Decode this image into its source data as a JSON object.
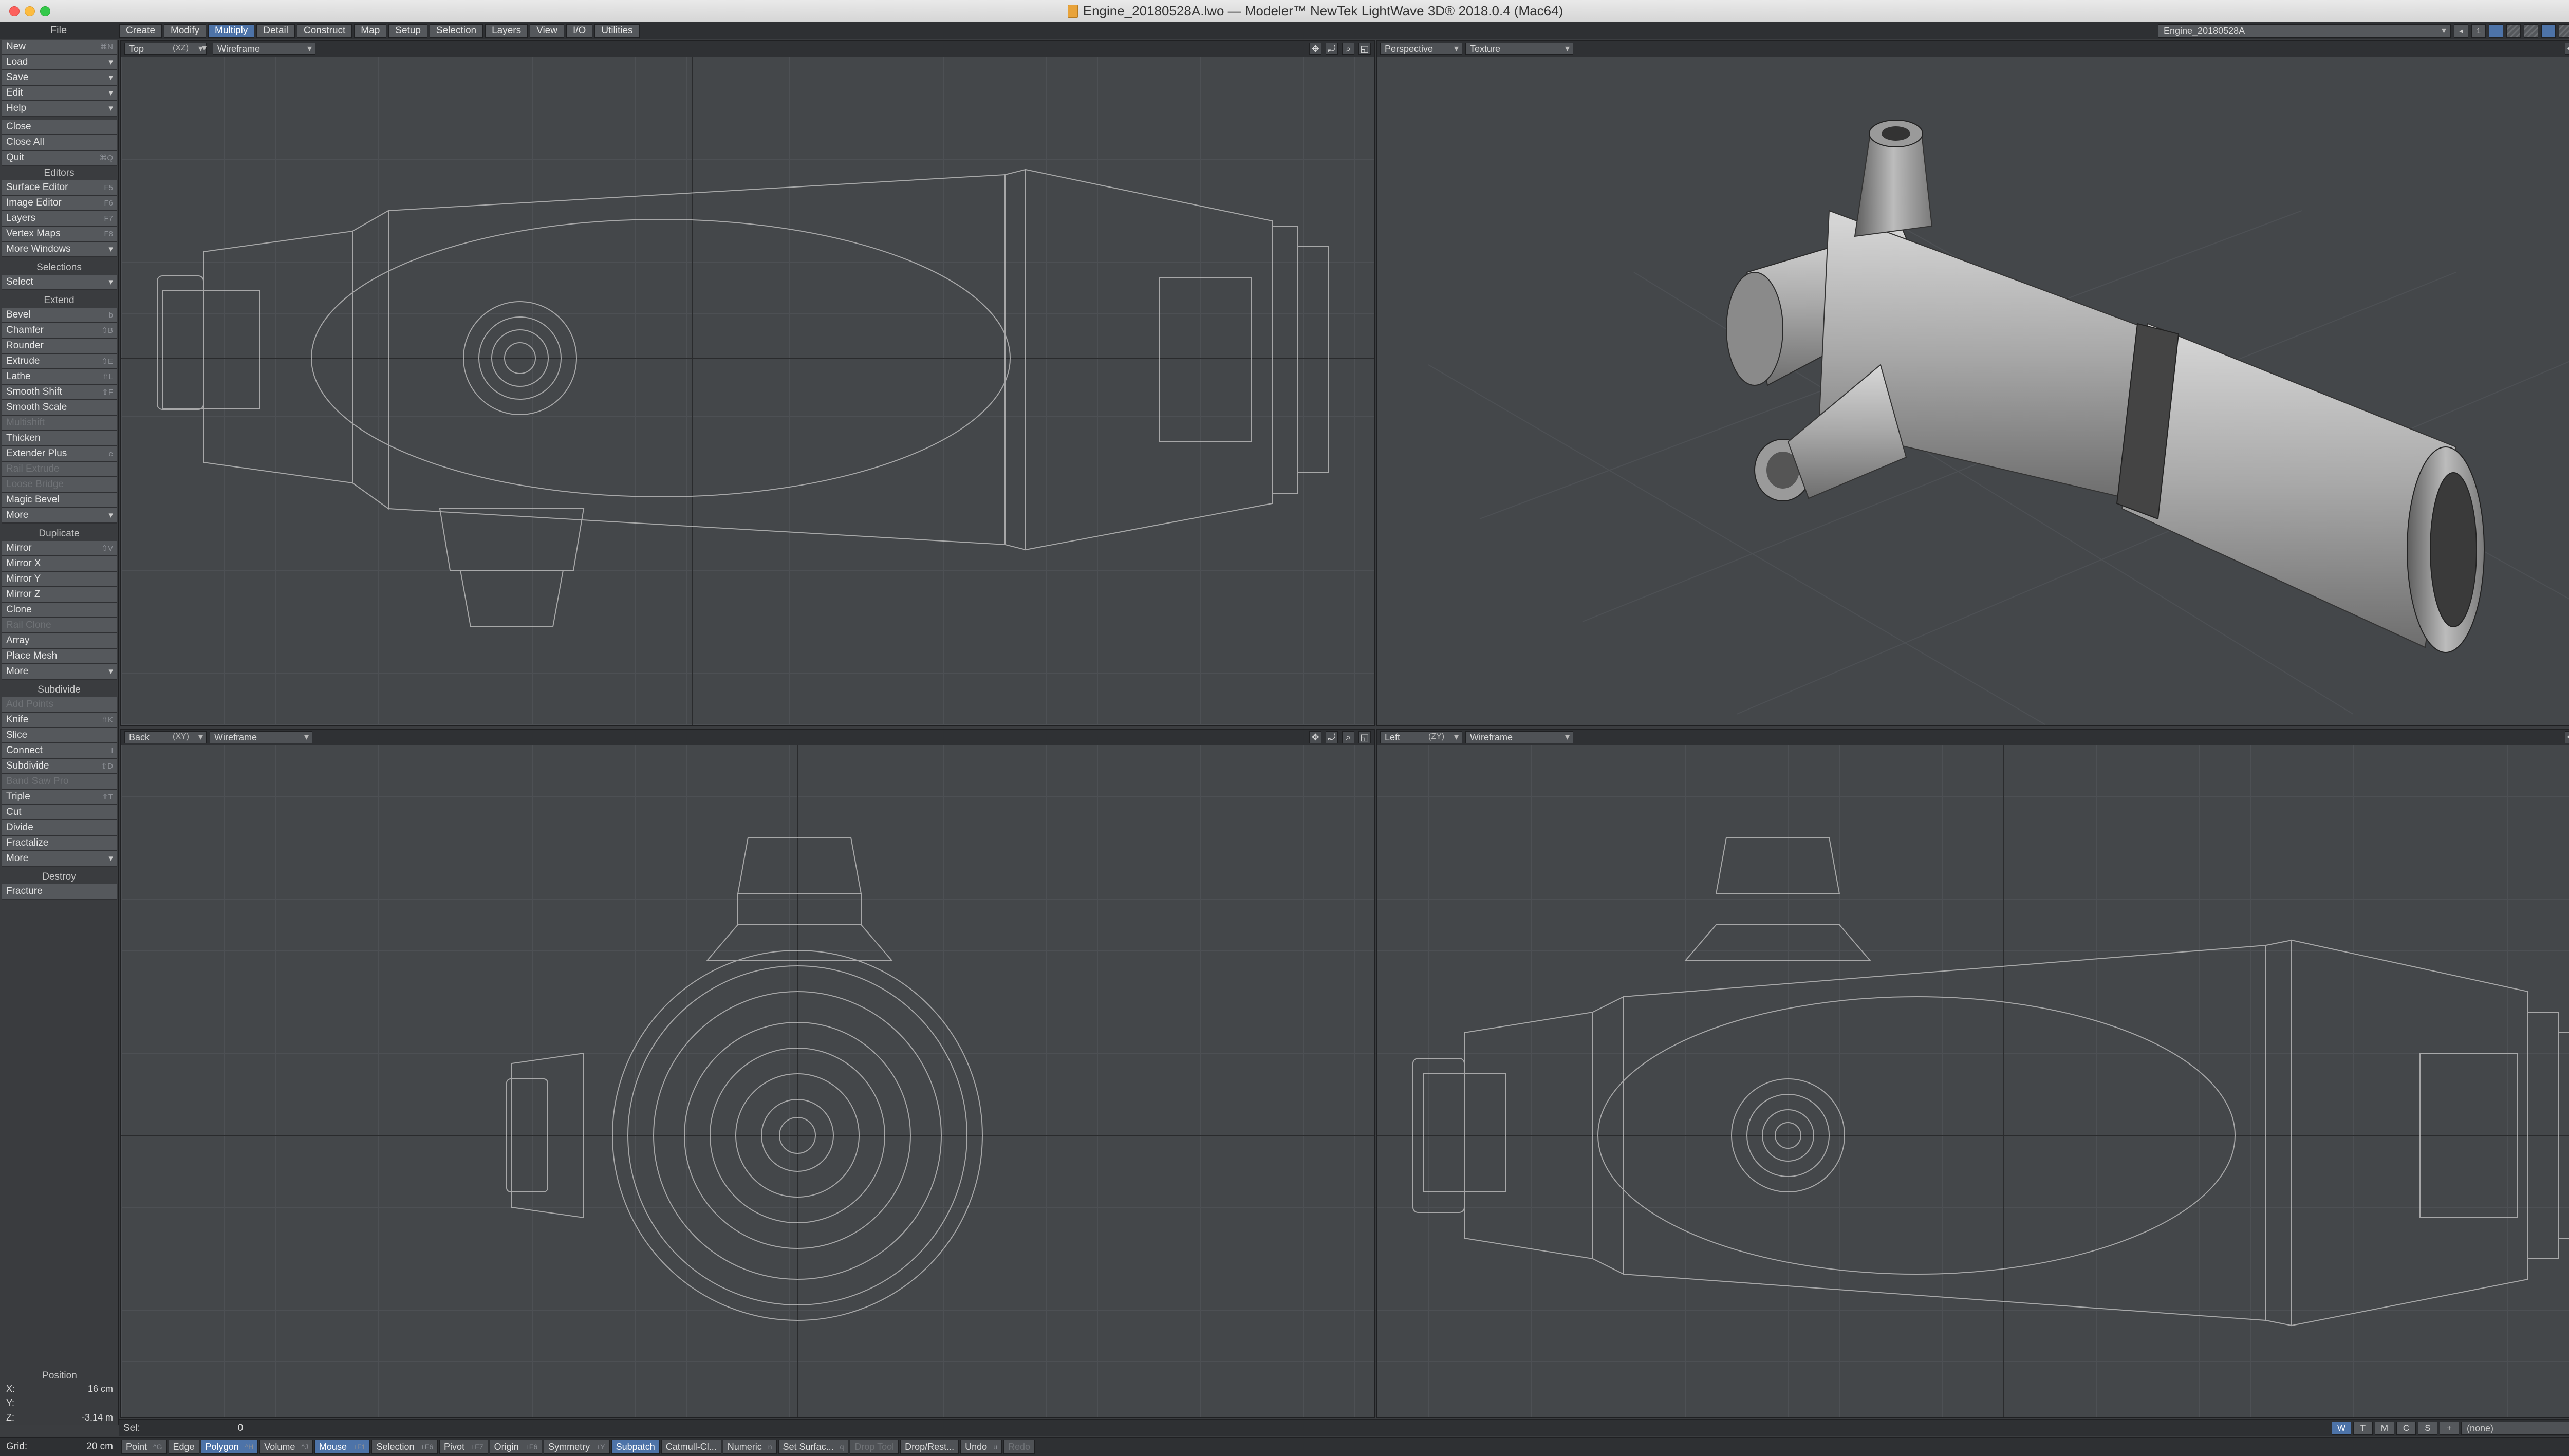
{
  "window": {
    "title": "Engine_20180528A.lwo — Modeler™ NewTek LightWave 3D® 2018.0.4 (Mac64)"
  },
  "menubar": {
    "file_label": "File",
    "tabs": [
      {
        "label": "Create",
        "active": false
      },
      {
        "label": "Modify",
        "active": false
      },
      {
        "label": "Multiply",
        "active": true
      },
      {
        "label": "Detail",
        "active": false
      },
      {
        "label": "Construct",
        "active": false
      },
      {
        "label": "Map",
        "active": false
      },
      {
        "label": "Setup",
        "active": false
      },
      {
        "label": "Selection",
        "active": false
      },
      {
        "label": "Layers",
        "active": false
      },
      {
        "label": "View",
        "active": false
      },
      {
        "label": "I/O",
        "active": false
      },
      {
        "label": "Utilities",
        "active": false
      }
    ],
    "object_select": "Engine_20180528A",
    "layer_number": "1"
  },
  "sidebar": {
    "file_items": [
      {
        "label": "New",
        "shortcut": "⌘N"
      },
      {
        "label": "Load",
        "shortcut": "",
        "dropdown": true
      },
      {
        "label": "Save",
        "shortcut": "",
        "dropdown": true
      },
      {
        "label": "Edit",
        "shortcut": "",
        "dropdown": true
      },
      {
        "label": "Help",
        "shortcut": "",
        "dropdown": true
      }
    ],
    "file_items2": [
      {
        "label": "Close",
        "shortcut": ""
      },
      {
        "label": "Close All",
        "shortcut": ""
      },
      {
        "label": "Quit",
        "shortcut": "⌘Q"
      }
    ],
    "editors_header": "Editors",
    "editors": [
      {
        "label": "Surface Editor",
        "shortcut": "F5"
      },
      {
        "label": "Image Editor",
        "shortcut": "F6"
      },
      {
        "label": "Layers",
        "shortcut": "F7"
      },
      {
        "label": "Vertex Maps",
        "shortcut": "F8"
      },
      {
        "label": "More Windows",
        "shortcut": "",
        "dropdown": true
      }
    ],
    "selections_header": "Selections",
    "selections": [
      {
        "label": "Select",
        "shortcut": "",
        "dropdown": true
      }
    ],
    "extend_header": "Extend",
    "extend": [
      {
        "label": "Bevel",
        "shortcut": "b"
      },
      {
        "label": "Chamfer",
        "shortcut": "⇧B"
      },
      {
        "label": "Rounder",
        "shortcut": ""
      },
      {
        "label": "Extrude",
        "shortcut": "⇧E"
      },
      {
        "label": "Lathe",
        "shortcut": "⇧L"
      },
      {
        "label": "Smooth Shift",
        "shortcut": "⇧F"
      },
      {
        "label": "Smooth Scale",
        "shortcut": ""
      },
      {
        "label": "Multishift",
        "shortcut": "",
        "disabled": true
      },
      {
        "label": "Thicken",
        "shortcut": ""
      },
      {
        "label": "Extender Plus",
        "shortcut": "e"
      },
      {
        "label": "Rail Extrude",
        "shortcut": "",
        "disabled": true
      },
      {
        "label": "Loose Bridge",
        "shortcut": "",
        "disabled": true
      },
      {
        "label": "Magic Bevel",
        "shortcut": ""
      },
      {
        "label": "More",
        "shortcut": "",
        "dropdown": true
      }
    ],
    "duplicate_header": "Duplicate",
    "duplicate": [
      {
        "label": "Mirror",
        "shortcut": "⇧V"
      },
      {
        "label": "Mirror X",
        "shortcut": ""
      },
      {
        "label": "Mirror Y",
        "shortcut": ""
      },
      {
        "label": "Mirror Z",
        "shortcut": ""
      },
      {
        "label": "Clone",
        "shortcut": ""
      },
      {
        "label": "Rail Clone",
        "shortcut": "",
        "disabled": true
      },
      {
        "label": "Array",
        "shortcut": ""
      },
      {
        "label": "Place Mesh",
        "shortcut": ""
      },
      {
        "label": "More",
        "shortcut": "",
        "dropdown": true
      }
    ],
    "subdivide_header": "Subdivide",
    "subdivide": [
      {
        "label": "Add Points",
        "shortcut": "",
        "disabled": true
      },
      {
        "label": "Knife",
        "shortcut": "⇧K"
      },
      {
        "label": "Slice",
        "shortcut": ""
      },
      {
        "label": "Connect",
        "shortcut": "l"
      },
      {
        "label": "Subdivide",
        "shortcut": "⇧D"
      },
      {
        "label": "Band Saw Pro",
        "shortcut": "",
        "disabled": true
      },
      {
        "label": "Triple",
        "shortcut": "⇧T"
      },
      {
        "label": "Cut",
        "shortcut": ""
      },
      {
        "label": "Divide",
        "shortcut": ""
      },
      {
        "label": "Fractalize",
        "shortcut": ""
      },
      {
        "label": "More",
        "shortcut": "",
        "dropdown": true
      }
    ],
    "destroy_header": "Destroy",
    "destroy": [
      {
        "label": "Fracture",
        "shortcut": ""
      }
    ],
    "position": {
      "title": "Position",
      "x_label": "X:",
      "x_value": "16 cm",
      "y_label": "Y:",
      "y_value": "",
      "z_label": "Z:",
      "z_value": "-3.14 m"
    }
  },
  "viewports": {
    "top_left": {
      "view": "Top",
      "axes": "(XZ)",
      "mode": "Wireframe"
    },
    "top_right": {
      "view": "Perspective",
      "mode": "Texture"
    },
    "bottom_left": {
      "view": "Back",
      "axes": "(XY)",
      "mode": "Wireframe"
    },
    "bottom_right": {
      "view": "Left",
      "axes": "(ZY)",
      "mode": "Wireframe"
    }
  },
  "statusbar": {
    "sel_label": "Sel:",
    "sel_value": "0",
    "wtmcs": [
      "W",
      "T",
      "M",
      "C",
      "S",
      "+"
    ],
    "none_select": "(none)"
  },
  "modebar": {
    "grid_label": "Grid:",
    "grid_value": "20 cm",
    "items": [
      {
        "label": "Point",
        "shortcut": "^G",
        "on": false
      },
      {
        "label": "Edge",
        "shortcut": "",
        "on": false
      },
      {
        "label": "Polygon",
        "shortcut": "^H",
        "on": true
      },
      {
        "label": "Volume",
        "shortcut": "^J",
        "on": false
      },
      {
        "label": "Mouse",
        "shortcut": "+F1",
        "on": true
      },
      {
        "label": "Selection",
        "shortcut": "+F6",
        "on": false
      },
      {
        "label": "Pivot",
        "shortcut": "+F7",
        "on": false
      },
      {
        "label": "Origin",
        "shortcut": "+F6",
        "on": false
      },
      {
        "label": "Symmetry",
        "shortcut": "+Y",
        "on": false
      },
      {
        "label": "Subpatch",
        "shortcut": "",
        "on": true
      },
      {
        "label": "Catmull-Cl...",
        "shortcut": "",
        "on": false
      },
      {
        "label": "Numeric",
        "shortcut": "n",
        "on": false
      },
      {
        "label": "Set Surfac...",
        "shortcut": "q",
        "on": false
      },
      {
        "label": "Drop Tool",
        "shortcut": "",
        "on": false,
        "disabled": true
      },
      {
        "label": "Drop/Rest...",
        "shortcut": "",
        "on": false
      },
      {
        "label": "Undo",
        "shortcut": "u",
        "on": false
      },
      {
        "label": "Redo",
        "shortcut": "",
        "on": false,
        "disabled": true
      }
    ]
  }
}
